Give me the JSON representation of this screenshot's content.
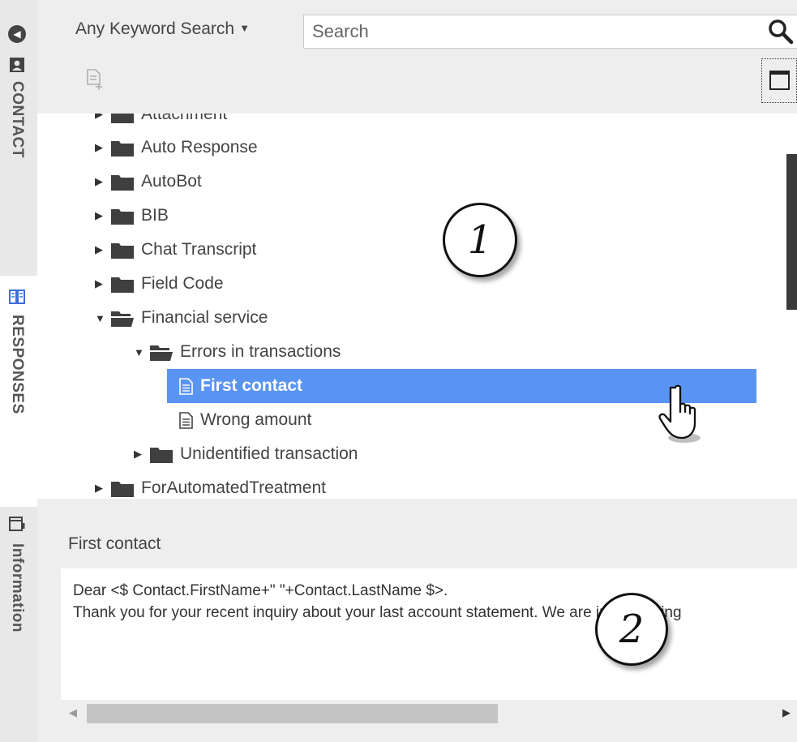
{
  "rail": {
    "contact_label": "CONTACT",
    "responses_label": "RESPONSES",
    "information_label": "Information",
    "active_color": "#3d6fd9"
  },
  "search": {
    "type_label": "Any Keyword Search",
    "placeholder": "Search"
  },
  "tree": {
    "items": [
      {
        "label": "Attachment",
        "type": "folder",
        "level": 0,
        "expanded": false
      },
      {
        "label": "Auto Response",
        "type": "folder",
        "level": 0,
        "expanded": false
      },
      {
        "label": "AutoBot",
        "type": "folder",
        "level": 0,
        "expanded": false
      },
      {
        "label": "BIB",
        "type": "folder",
        "level": 0,
        "expanded": false
      },
      {
        "label": "Chat Transcript",
        "type": "folder",
        "level": 0,
        "expanded": false
      },
      {
        "label": "Field Code",
        "type": "folder",
        "level": 0,
        "expanded": false
      },
      {
        "label": "Financial service",
        "type": "folder",
        "level": 0,
        "expanded": true
      },
      {
        "label": "Errors in transactions",
        "type": "folder",
        "level": 1,
        "expanded": true
      },
      {
        "label": "First contact",
        "type": "response",
        "level": 2,
        "selected": true
      },
      {
        "label": "Wrong amount",
        "type": "response",
        "level": 2
      },
      {
        "label": "Unidentified transaction",
        "type": "folder",
        "level": 1,
        "expanded": false
      },
      {
        "label": "ForAutomatedTreatment",
        "type": "folder",
        "level": 0,
        "expanded": false
      }
    ],
    "selected_color": "#5a94f2"
  },
  "annotations": {
    "marker_1": "1",
    "marker_2": "2"
  },
  "preview": {
    "title": "First contact",
    "lines": [
      "Dear <$ Contact.FirstName+\" \"+Contact.LastName $>.",
      "Thank you for your recent inquiry about your last account statement. We are investigating"
    ]
  },
  "icons": {
    "back": "back-arrow-icon",
    "contact": "contact-card-icon",
    "responses": "book-icon",
    "information": "information-panel-icon",
    "search": "search-icon",
    "insert": "insert-response-icon",
    "window": "window-icon",
    "folder": "folder-icon",
    "document": "document-icon",
    "cursor": "hand-pointer-icon"
  }
}
